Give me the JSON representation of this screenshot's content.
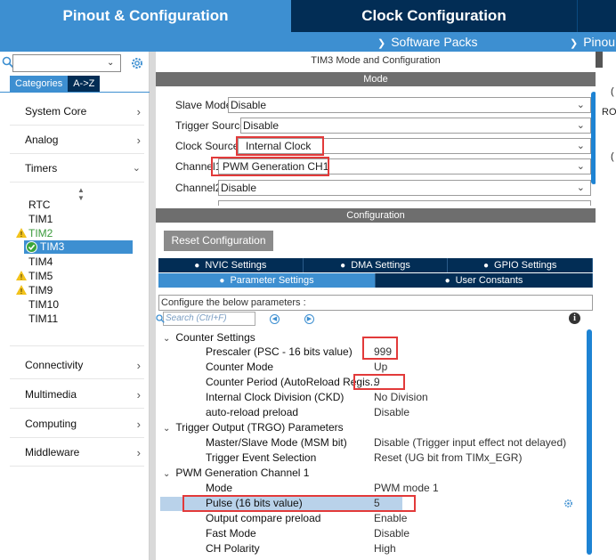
{
  "tabs": {
    "pinout": "Pinout & Configuration",
    "clock": "Clock Configuration"
  },
  "subbar": {
    "software_packs": "Software Packs",
    "pinout": "Pinou"
  },
  "sidebar": {
    "search_value": "",
    "cat_tabs": [
      "Categories",
      "A->Z"
    ],
    "categories": {
      "system_core": "System Core",
      "analog": "Analog",
      "timers": "Timers",
      "connectivity": "Connectivity",
      "multimedia": "Multimedia",
      "computing": "Computing",
      "middleware": "Middleware"
    },
    "timers": [
      "RTC",
      "TIM1",
      "TIM2",
      "TIM3",
      "TIM4",
      "TIM5",
      "TIM9",
      "TIM10",
      "TIM11"
    ]
  },
  "mode_panel": {
    "title": "TIM3 Mode and Configuration",
    "mode_header": "Mode",
    "rows": [
      {
        "label": "Slave Mode",
        "value": "Disable"
      },
      {
        "label": "Trigger Source",
        "value": "Disable"
      },
      {
        "label": "Clock Source",
        "value": "Internal Clock"
      },
      {
        "label": "Channel1",
        "value": "PWM Generation CH1"
      },
      {
        "label": "Channel2",
        "value": "Disable"
      }
    ]
  },
  "config_panel": {
    "header": "Configuration",
    "reset_button": "Reset Configuration",
    "tabs_row1": [
      "NVIC Settings",
      "DMA Settings",
      "GPIO Settings"
    ],
    "tabs_row2": [
      "Parameter Settings",
      "User Constants"
    ],
    "configure_text": "Configure the below parameters :",
    "search_placeholder": "Search (Ctrl+F)",
    "groups": {
      "counter": "Counter Settings",
      "trgo": "Trigger Output (TRGO) Parameters",
      "pwm": "PWM Generation Channel 1"
    },
    "params": [
      {
        "name": "Prescaler (PSC - 16 bits value)",
        "value": "999"
      },
      {
        "name": "Counter Mode",
        "value": "Up"
      },
      {
        "name": "Counter Period (AutoReload Regis...",
        "value": "9"
      },
      {
        "name": "Internal Clock Division (CKD)",
        "value": "No Division"
      },
      {
        "name": "auto-reload preload",
        "value": "Disable"
      },
      {
        "name": "Master/Slave Mode (MSM bit)",
        "value": "Disable (Trigger input effect not delayed)"
      },
      {
        "name": "Trigger Event Selection",
        "value": "Reset (UG bit from TIMx_EGR)"
      },
      {
        "name": "Mode",
        "value": "PWM mode 1"
      },
      {
        "name": "Pulse (16 bits value)",
        "value": "5"
      },
      {
        "name": "Output compare preload",
        "value": "Enable"
      },
      {
        "name": "Fast Mode",
        "value": "Disable"
      },
      {
        "name": "CH Polarity",
        "value": "High"
      }
    ]
  },
  "right_edge": {
    "letters": [
      "(",
      "RO",
      "("
    ]
  },
  "colors": {
    "accent": "#3d8fd1",
    "navy": "#022d55",
    "highlight_red": "#e23a3a",
    "warning": "#f2c21b",
    "ok_green": "#3aa53a"
  }
}
